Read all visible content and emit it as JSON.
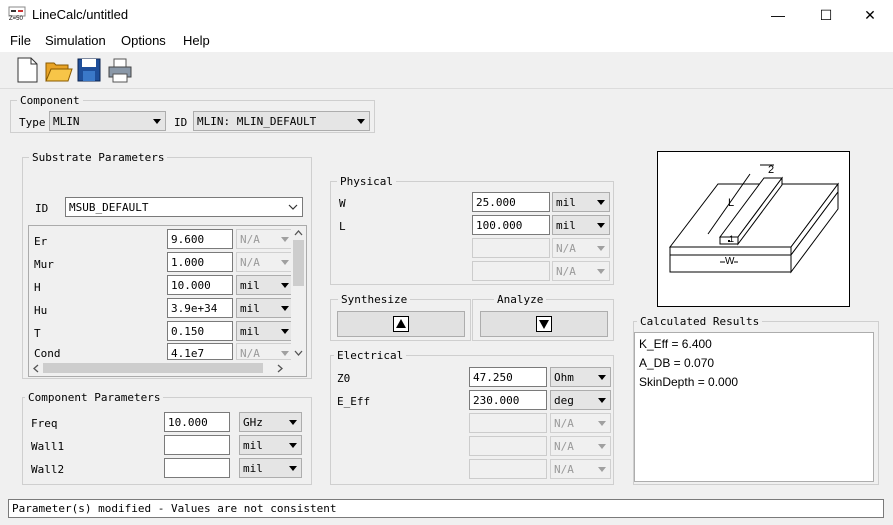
{
  "window": {
    "title": "LineCalc/untitled",
    "icon_text": "Z=50",
    "minimize_glyph": "—",
    "maximize_glyph": "☐",
    "close_glyph": "✕"
  },
  "menu": [
    "File",
    "Simulation",
    "Options",
    "Help"
  ],
  "toolbar": {
    "icons": [
      "new-file-icon",
      "open-folder-icon",
      "save-disk-icon",
      "print-icon"
    ]
  },
  "component": {
    "title": "Component",
    "type_label": "Type",
    "type_value": "MLIN",
    "id_label": "ID",
    "id_value": "MLIN: MLIN_DEFAULT"
  },
  "substrate": {
    "title": "Substrate Parameters",
    "id_label": "ID",
    "id_value": "MSUB_DEFAULT",
    "rows": [
      {
        "name": "Er",
        "value": "9.600",
        "unit": "N/A",
        "unit_enabled": false
      },
      {
        "name": "Mur",
        "value": "1.000",
        "unit": "N/A",
        "unit_enabled": false
      },
      {
        "name": "H",
        "value": "10.000",
        "unit": "mil",
        "unit_enabled": true
      },
      {
        "name": "Hu",
        "value": "3.9e+34",
        "unit": "mil",
        "unit_enabled": true
      },
      {
        "name": "T",
        "value": "0.150",
        "unit": "mil",
        "unit_enabled": true
      },
      {
        "name": "Cond",
        "value": "4.1e7",
        "unit": "N/A",
        "unit_enabled": false
      }
    ]
  },
  "component_params": {
    "title": "Component Parameters",
    "rows": [
      {
        "name": "Freq",
        "value": "10.000",
        "unit": "GHz"
      },
      {
        "name": "Wall1",
        "value": "",
        "unit": "mil"
      },
      {
        "name": "Wall2",
        "value": "",
        "unit": "mil"
      }
    ]
  },
  "physical": {
    "title": "Physical",
    "rows": [
      {
        "name": "W",
        "value": "25.000",
        "unit": "mil",
        "enabled": true
      },
      {
        "name": "L",
        "value": "100.000",
        "unit": "mil",
        "enabled": true
      },
      {
        "name": "",
        "value": "",
        "unit": "N/A",
        "enabled": false
      },
      {
        "name": "",
        "value": "",
        "unit": "N/A",
        "enabled": false
      }
    ]
  },
  "synthesize": {
    "title": "Synthesize",
    "icon": "up-triangle-icon"
  },
  "analyze": {
    "title": "Analyze",
    "icon": "down-triangle-icon"
  },
  "electrical": {
    "title": "Electrical",
    "rows": [
      {
        "name": "Z0",
        "value": "47.250",
        "unit": "Ohm",
        "enabled": true
      },
      {
        "name": "E_Eff",
        "value": "230.000",
        "unit": "deg",
        "enabled": true
      },
      {
        "name": "",
        "value": "",
        "unit": "N/A",
        "enabled": false
      },
      {
        "name": "",
        "value": "",
        "unit": "N/A",
        "enabled": false
      },
      {
        "name": "",
        "value": "",
        "unit": "N/A",
        "enabled": false
      }
    ]
  },
  "diagram": {
    "label_2": "2",
    "label_L": "L",
    "label_1": "1",
    "label_W": "W"
  },
  "results": {
    "title": "Calculated Results",
    "lines": [
      "K_Eff = 6.400",
      "A_DB = 0.070",
      "SkinDepth = 0.000"
    ]
  },
  "status": "Parameter(s) modified - Values are not consistent"
}
